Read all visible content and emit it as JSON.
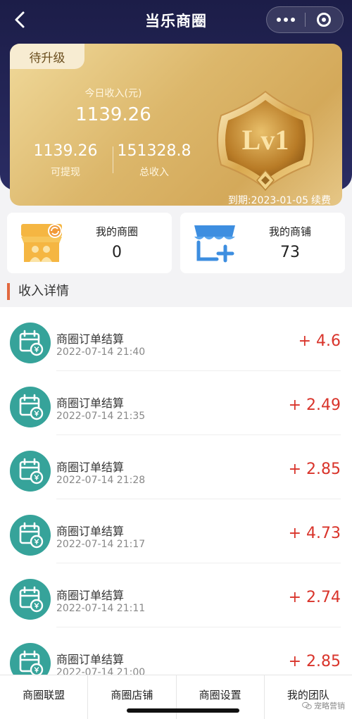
{
  "nav": {
    "title": "当乐商圈",
    "back_icon": "chevron-left-icon",
    "more_icon": "more-dots-icon",
    "close_icon": "target-close-icon"
  },
  "card": {
    "badge": "待升级",
    "today_label": "今日收入(元)",
    "today_value": "1139.26",
    "withdrawable_value": "1139.26",
    "withdrawable_label": "可提现",
    "total_value": "151328.8",
    "total_label": "总收入",
    "level": "Lv1",
    "expiry": "到期:2023-01-05",
    "renew": "续费"
  },
  "tiles": [
    {
      "label": "我的商圈",
      "value": "0",
      "icon": "shop-group-icon"
    },
    {
      "label": "我的商铺",
      "value": "73",
      "icon": "store-add-icon"
    }
  ],
  "section_title": "收入详情",
  "records": [
    {
      "title": "商圈订单结算",
      "time": "2022-07-14 21:40",
      "amount": "+ 4.6"
    },
    {
      "title": "商圈订单结算",
      "time": "2022-07-14 21:35",
      "amount": "+ 2.49"
    },
    {
      "title": "商圈订单结算",
      "time": "2022-07-14 21:28",
      "amount": "+ 2.85"
    },
    {
      "title": "商圈订单结算",
      "time": "2022-07-14 21:17",
      "amount": "+ 4.73"
    },
    {
      "title": "商圈订单结算",
      "time": "2022-07-14 21:11",
      "amount": "+ 2.74"
    },
    {
      "title": "商圈订单结算",
      "time": "2022-07-14 21:00",
      "amount": "+ 2.85"
    }
  ],
  "tabs": [
    "商圈联盟",
    "商圈店铺",
    "商圈设置",
    "我的团队"
  ],
  "watermark": "宠略营销",
  "colors": {
    "header": "#1c1d48",
    "gold": "#dcb76b",
    "accent": "#e2683f",
    "amount": "#d9342b",
    "record_icon": "#36a39a"
  }
}
